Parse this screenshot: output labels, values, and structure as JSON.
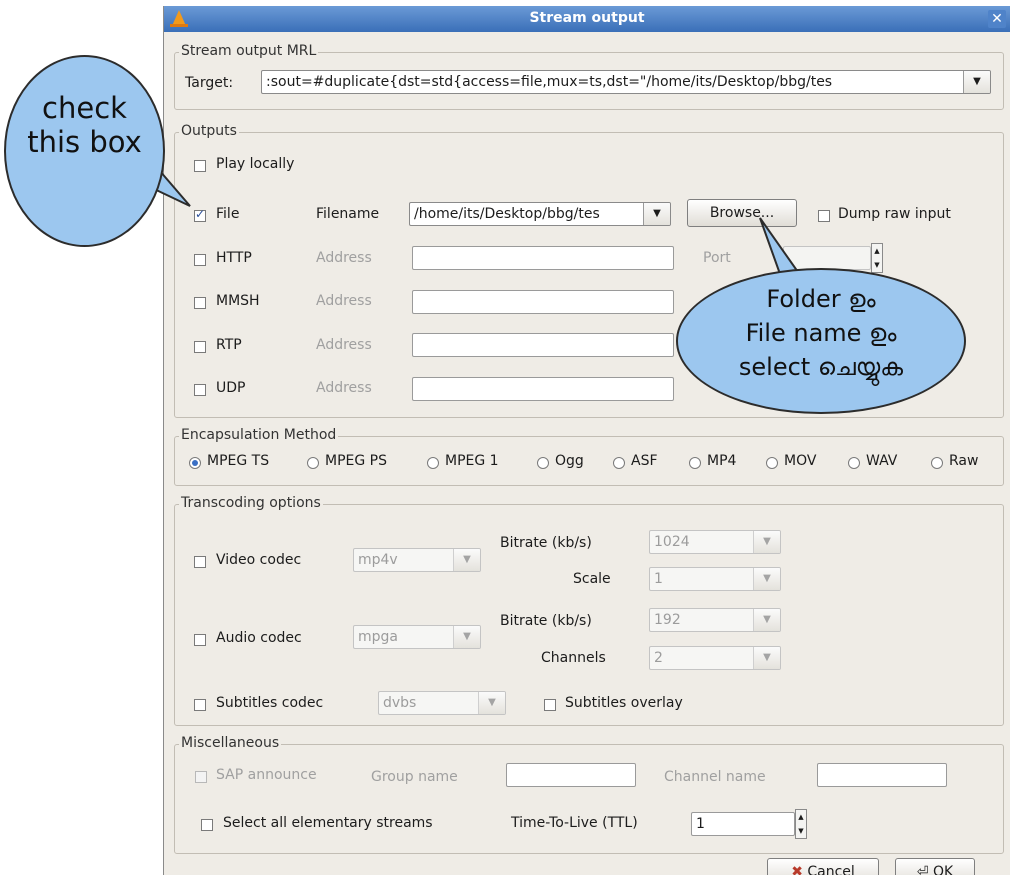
{
  "window": {
    "title": "Stream output"
  },
  "mrl": {
    "group_label": "Stream output MRL",
    "target_label": "Target:",
    "target_value": ":sout=#duplicate{dst=std{access=file,mux=ts,dst=\"/home/its/Desktop/bbg/tes"
  },
  "outputs": {
    "group_label": "Outputs",
    "play_locally": "Play locally",
    "file": {
      "label": "File",
      "checked": true,
      "filename_label": "Filename",
      "filename_value": "/home/its/Desktop/bbg/tes",
      "browse_label": "Browse...",
      "dump_label": "Dump raw input"
    },
    "address_label": "Address",
    "port_label": "Port",
    "protocols": [
      "HTTP",
      "MMSH",
      "RTP",
      "UDP"
    ]
  },
  "encapsulation": {
    "group_label": "Encapsulation Method",
    "options": [
      "MPEG TS",
      "MPEG PS",
      "MPEG 1",
      "Ogg",
      "ASF",
      "MP4",
      "MOV",
      "WAV",
      "Raw"
    ],
    "selected": "MPEG TS"
  },
  "transcoding": {
    "group_label": "Transcoding options",
    "video_label": "Video codec",
    "video_codec": "mp4v",
    "video_bitrate_label": "Bitrate (kb/s)",
    "video_bitrate": "1024",
    "scale_label": "Scale",
    "scale": "1",
    "audio_label": "Audio codec",
    "audio_codec": "mpga",
    "audio_bitrate_label": "Bitrate (kb/s)",
    "audio_bitrate": "192",
    "channels_label": "Channels",
    "channels": "2",
    "subs_label": "Subtitles codec",
    "subs_codec": "dvbs",
    "subs_overlay_label": "Subtitles overlay"
  },
  "misc": {
    "group_label": "Miscellaneous",
    "sap_label": "SAP announce",
    "group_name_label": "Group name",
    "channel_name_label": "Channel name",
    "select_all_label": "Select all elementary streams",
    "ttl_label": "Time-To-Live (TTL)",
    "ttl_value": "1"
  },
  "footer": {
    "cancel_label": "Cancel",
    "ok_label": "OK"
  },
  "annotations": {
    "left_bubble": "check this box",
    "right_bubble_line1": "Folder ഉം",
    "right_bubble_line2": "File name ഉം",
    "right_bubble_line3": "select ചെയ്യുക"
  },
  "colors": {
    "title_bar": "#3a6fb8",
    "bubble_fill": "#9cc7ef",
    "dialog_bg": "#efece6"
  }
}
